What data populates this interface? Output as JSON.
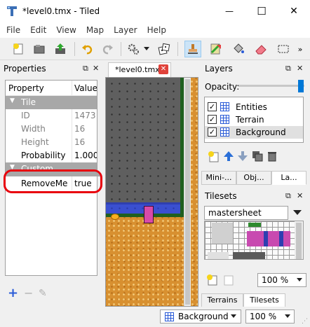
{
  "window": {
    "title": "*level0.tmx - Tiled",
    "minimize_glyph": "—",
    "maximize_glyph": "☐",
    "close_glyph": "✕"
  },
  "menu": [
    "File",
    "Edit",
    "View",
    "Map",
    "Layer",
    "Help"
  ],
  "toolbar": {
    "icons": [
      "new-map-icon",
      "open-icon",
      "save-icon",
      "undo-icon",
      "redo-icon",
      "commands-icon",
      "random-icon",
      "stamp-brush-icon",
      "terrain-brush-icon",
      "bucket-fill-icon",
      "eraser-icon",
      "rect-select-icon"
    ]
  },
  "properties_panel": {
    "title": "Properties",
    "columns": [
      "Property",
      "Value"
    ],
    "group_tile": "Tile",
    "rows": [
      {
        "key": "ID",
        "value": "1473"
      },
      {
        "key": "Width",
        "value": "16"
      },
      {
        "key": "Height",
        "value": "16"
      },
      {
        "key": "Probability",
        "value": "1.000"
      }
    ],
    "group_custom": "Custom Properties",
    "custom_rows": [
      {
        "key": "RemoveMe",
        "value": "true"
      }
    ],
    "highlight_color": "#e8000c",
    "add_glyph": "+",
    "remove_glyph": "−",
    "edit_glyph": "✎"
  },
  "document": {
    "tab_label": "*level0.tmx"
  },
  "layers_panel": {
    "title": "Layers",
    "opacity_label": "Opacity:",
    "opacity_value": 1.0,
    "layers": [
      {
        "name": "Entities",
        "checked": true
      },
      {
        "name": "Terrain",
        "checked": true
      },
      {
        "name": "Background",
        "checked": true
      }
    ],
    "tabs": [
      "Mini-...",
      "Obj...",
      "La..."
    ]
  },
  "tilesets_panel": {
    "title": "Tilesets",
    "tileset_name": "mastersheet",
    "zoom": "100 %",
    "tabs": [
      "Terrains",
      "Tilesets"
    ]
  },
  "statusbar": {
    "layer": "Background",
    "zoom": "100 %"
  },
  "colors": {
    "accent": "#0078d7",
    "selection": "#cce4f7"
  }
}
